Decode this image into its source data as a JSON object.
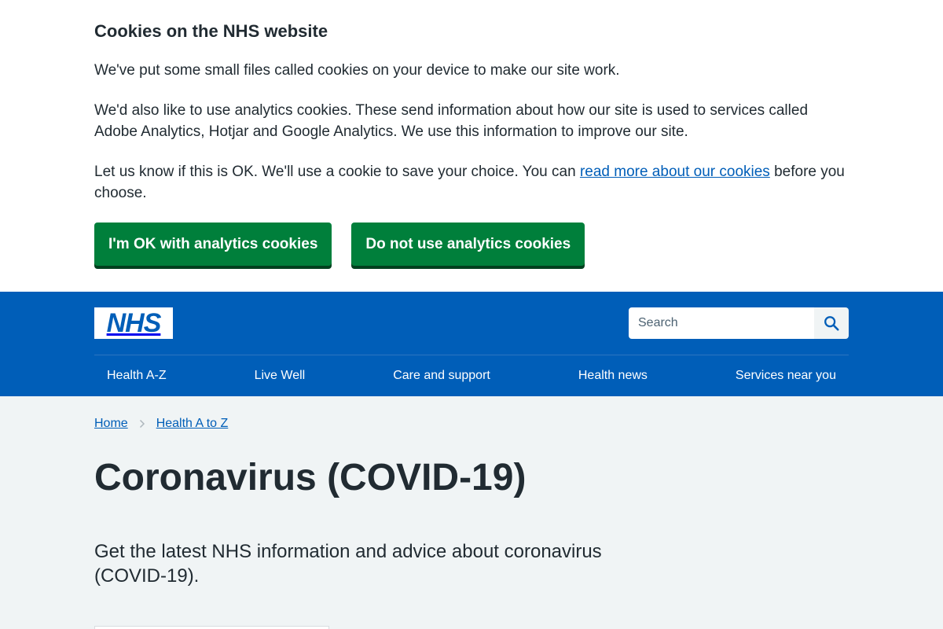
{
  "cookie_banner": {
    "title": "Cookies on the NHS website",
    "p1": "We've put some small files called cookies on your device to make our site work.",
    "p2": "We'd also like to use analytics cookies. These send information about how our site is used to services called Adobe Analytics, Hotjar and Google Analytics. We use this information to improve our site.",
    "p3_before": "Let us know if this is OK. We'll use a cookie to save your choice. You can ",
    "p3_link": "read more about our cookies",
    "p3_after": " before you choose.",
    "accept_label": "I'm OK with analytics cookies",
    "reject_label": "Do not use analytics cookies"
  },
  "header": {
    "logo_text": "NHS",
    "search": {
      "placeholder": "Search",
      "icon": "search-icon"
    },
    "nav": [
      {
        "label": "Health A-Z"
      },
      {
        "label": "Live Well"
      },
      {
        "label": "Care and support"
      },
      {
        "label": "Health news"
      },
      {
        "label": "Services near you"
      }
    ]
  },
  "breadcrumb": [
    {
      "label": "Home"
    },
    {
      "label": "Health A to Z"
    }
  ],
  "page": {
    "title": "Coronavirus (COVID-19)",
    "lede": "Get the latest NHS information and advice about coronavirus (COVID-19)."
  },
  "colors": {
    "nhs_blue": "#005eb8",
    "green": "#007f3b",
    "text": "#212b32",
    "background": "#f0f4f5"
  }
}
